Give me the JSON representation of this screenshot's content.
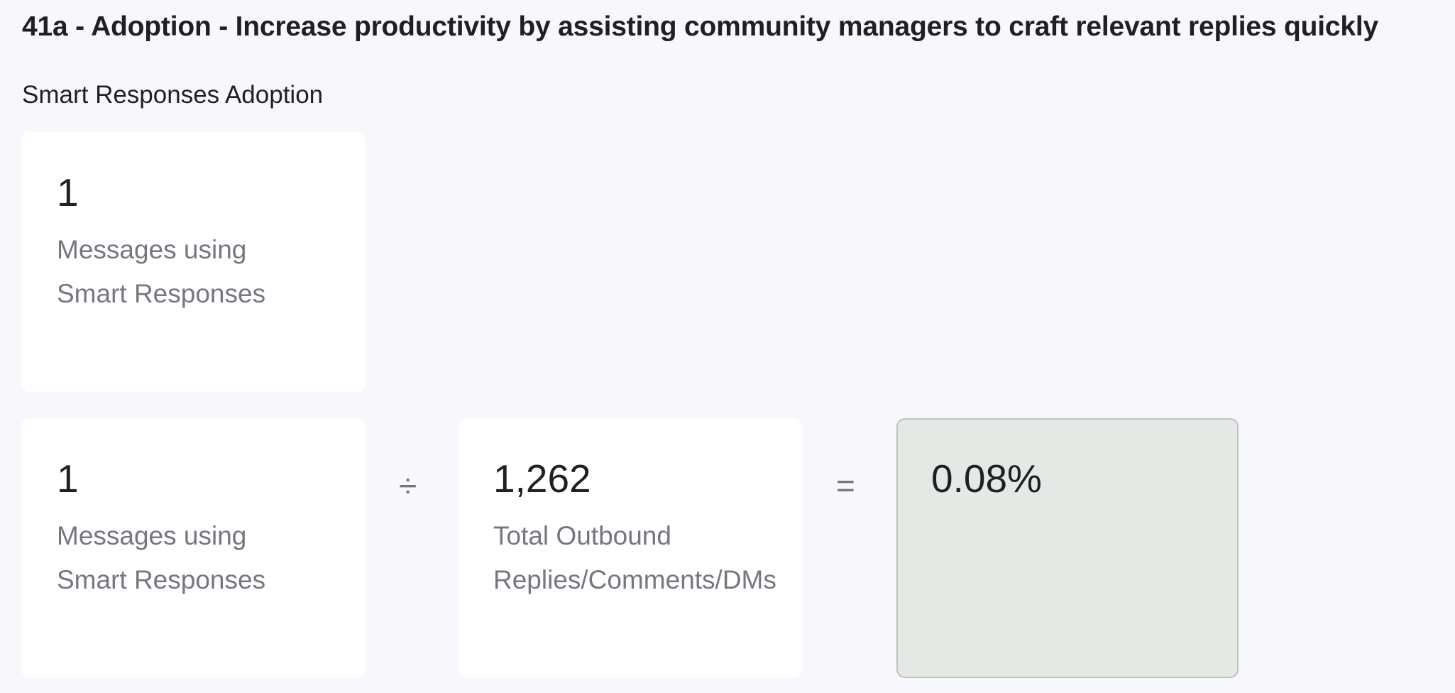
{
  "page": {
    "title": "41a - Adoption - Increase productivity by assisting community managers to craft relevant replies quickly"
  },
  "section": {
    "title": "Smart Responses Adoption"
  },
  "summary_card": {
    "value": "1",
    "label": "Messages using\nSmart Responses"
  },
  "formula": {
    "numerator": {
      "value": "1",
      "label": "Messages using\nSmart Responses"
    },
    "divide_symbol": "÷",
    "denominator": {
      "value": "1,262",
      "label": "Total Outbound\nReplies/Comments/DMs"
    },
    "equals_symbol": "=",
    "result": {
      "value": "0.08%"
    }
  }
}
